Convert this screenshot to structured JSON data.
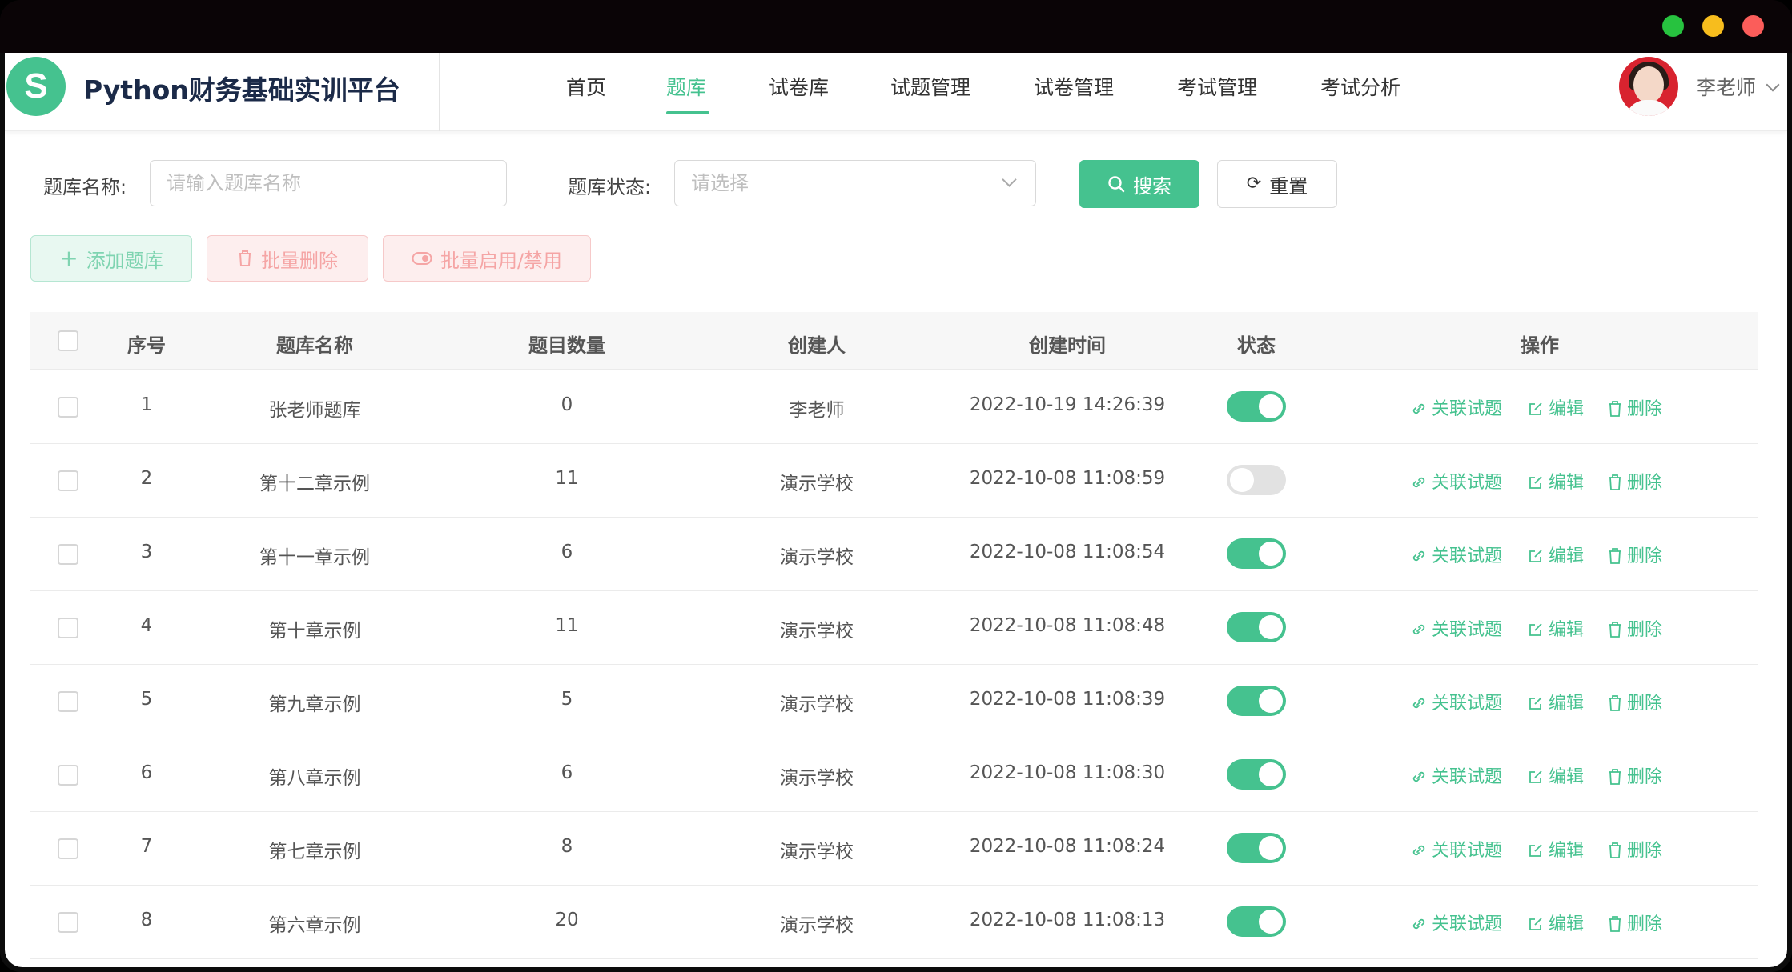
{
  "window": {
    "controls": [
      "green",
      "yellow",
      "red"
    ]
  },
  "header": {
    "logo_letter": "S",
    "app_title": "Python财务基础实训平台",
    "nav": [
      {
        "label": "首页",
        "active": false
      },
      {
        "label": "题库",
        "active": true
      },
      {
        "label": "试卷库",
        "active": false
      },
      {
        "label": "试题管理",
        "active": false
      },
      {
        "label": "试卷管理",
        "active": false
      },
      {
        "label": "考试管理",
        "active": false
      },
      {
        "label": "考试分析",
        "active": false
      }
    ],
    "user_name": "李老师"
  },
  "filters": {
    "name_label": "题库名称:",
    "name_placeholder": "请输入题库名称",
    "status_label": "题库状态:",
    "status_placeholder": "请选择",
    "search_label": "搜索",
    "reset_label": "重置"
  },
  "actions": {
    "add_label": "添加题库",
    "batch_delete_label": "批量删除",
    "batch_toggle_label": "批量启用/禁用"
  },
  "table": {
    "columns": [
      "序号",
      "题库名称",
      "题目数量",
      "创建人",
      "创建时间",
      "状态",
      "操作"
    ],
    "row_actions": {
      "link": "关联试题",
      "edit": "编辑",
      "delete": "删除"
    },
    "rows": [
      {
        "index": "1",
        "name": "张老师题库",
        "count": "0",
        "creator": "李老师",
        "created": "2022-10-19 14:26:39",
        "enabled": true
      },
      {
        "index": "2",
        "name": "第十二章示例",
        "count": "11",
        "creator": "演示学校",
        "created": "2022-10-08 11:08:59",
        "enabled": false
      },
      {
        "index": "3",
        "name": "第十一章示例",
        "count": "6",
        "creator": "演示学校",
        "created": "2022-10-08 11:08:54",
        "enabled": true
      },
      {
        "index": "4",
        "name": "第十章示例",
        "count": "11",
        "creator": "演示学校",
        "created": "2022-10-08 11:08:48",
        "enabled": true
      },
      {
        "index": "5",
        "name": "第九章示例",
        "count": "5",
        "creator": "演示学校",
        "created": "2022-10-08 11:08:39",
        "enabled": true
      },
      {
        "index": "6",
        "name": "第八章示例",
        "count": "6",
        "creator": "演示学校",
        "created": "2022-10-08 11:08:30",
        "enabled": true
      },
      {
        "index": "7",
        "name": "第七章示例",
        "count": "8",
        "creator": "演示学校",
        "created": "2022-10-08 11:08:24",
        "enabled": true
      },
      {
        "index": "8",
        "name": "第六章示例",
        "count": "20",
        "creator": "演示学校",
        "created": "2022-10-08 11:08:13",
        "enabled": true
      }
    ]
  },
  "colors": {
    "accent": "#45c28f",
    "danger_light": "#f5a5a5",
    "title": "#1b2a48"
  }
}
